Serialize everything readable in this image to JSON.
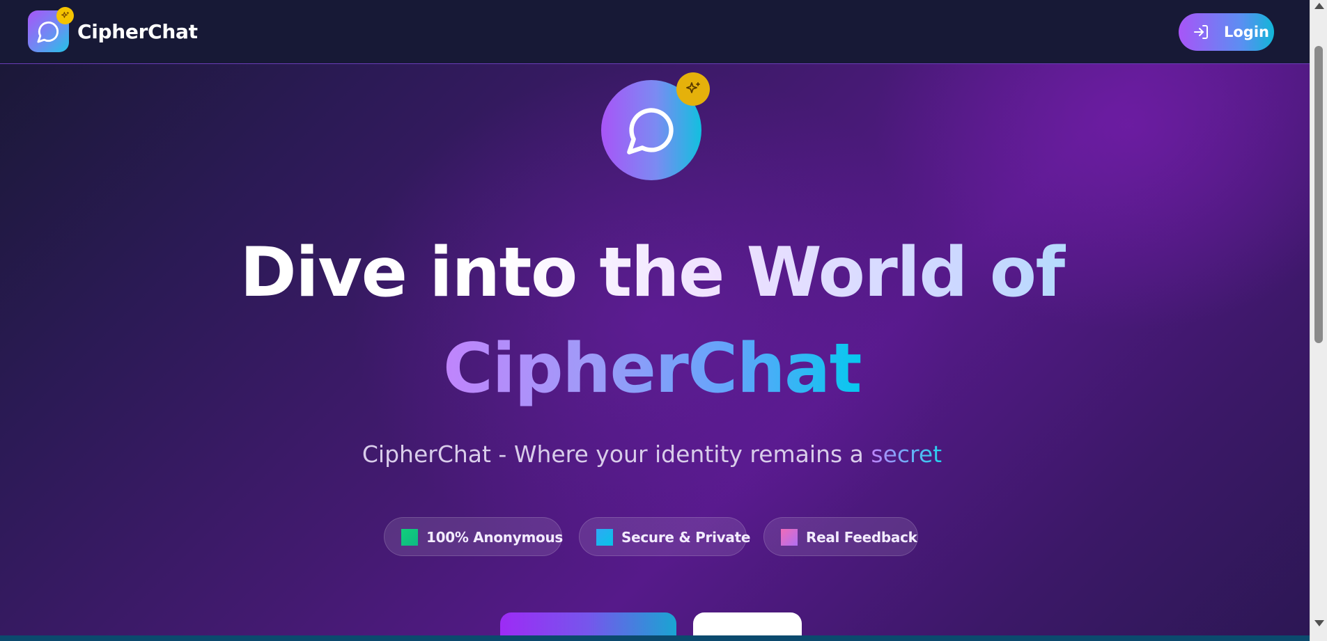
{
  "header": {
    "brand_name": "CipherChat",
    "brand_icon": "chat-bubble-icon",
    "brand_badge_icon": "sparkles-icon",
    "login_label": "Login",
    "login_icon": "log-in-icon"
  },
  "hero": {
    "icon": "chat-bubble-icon",
    "badge_icon": "sparkles-icon",
    "headline_line1": "Dive into the World of",
    "headline_line2": "CipherChat",
    "tagline_prefix": "CipherChat - Where your identity remains a ",
    "tagline_accent": "secret"
  },
  "features": [
    {
      "label": "100% Anonymous",
      "color": "#10d07a"
    },
    {
      "label": "Secure & Private",
      "color": "#1fb4ef"
    },
    {
      "label": "Real Feedback",
      "color": "#d96ee0"
    }
  ],
  "colors": {
    "accent_purple": "#a855f7",
    "accent_cyan": "#06c8ef",
    "badge_yellow": "#f5c400",
    "header_bg": "#171936"
  }
}
